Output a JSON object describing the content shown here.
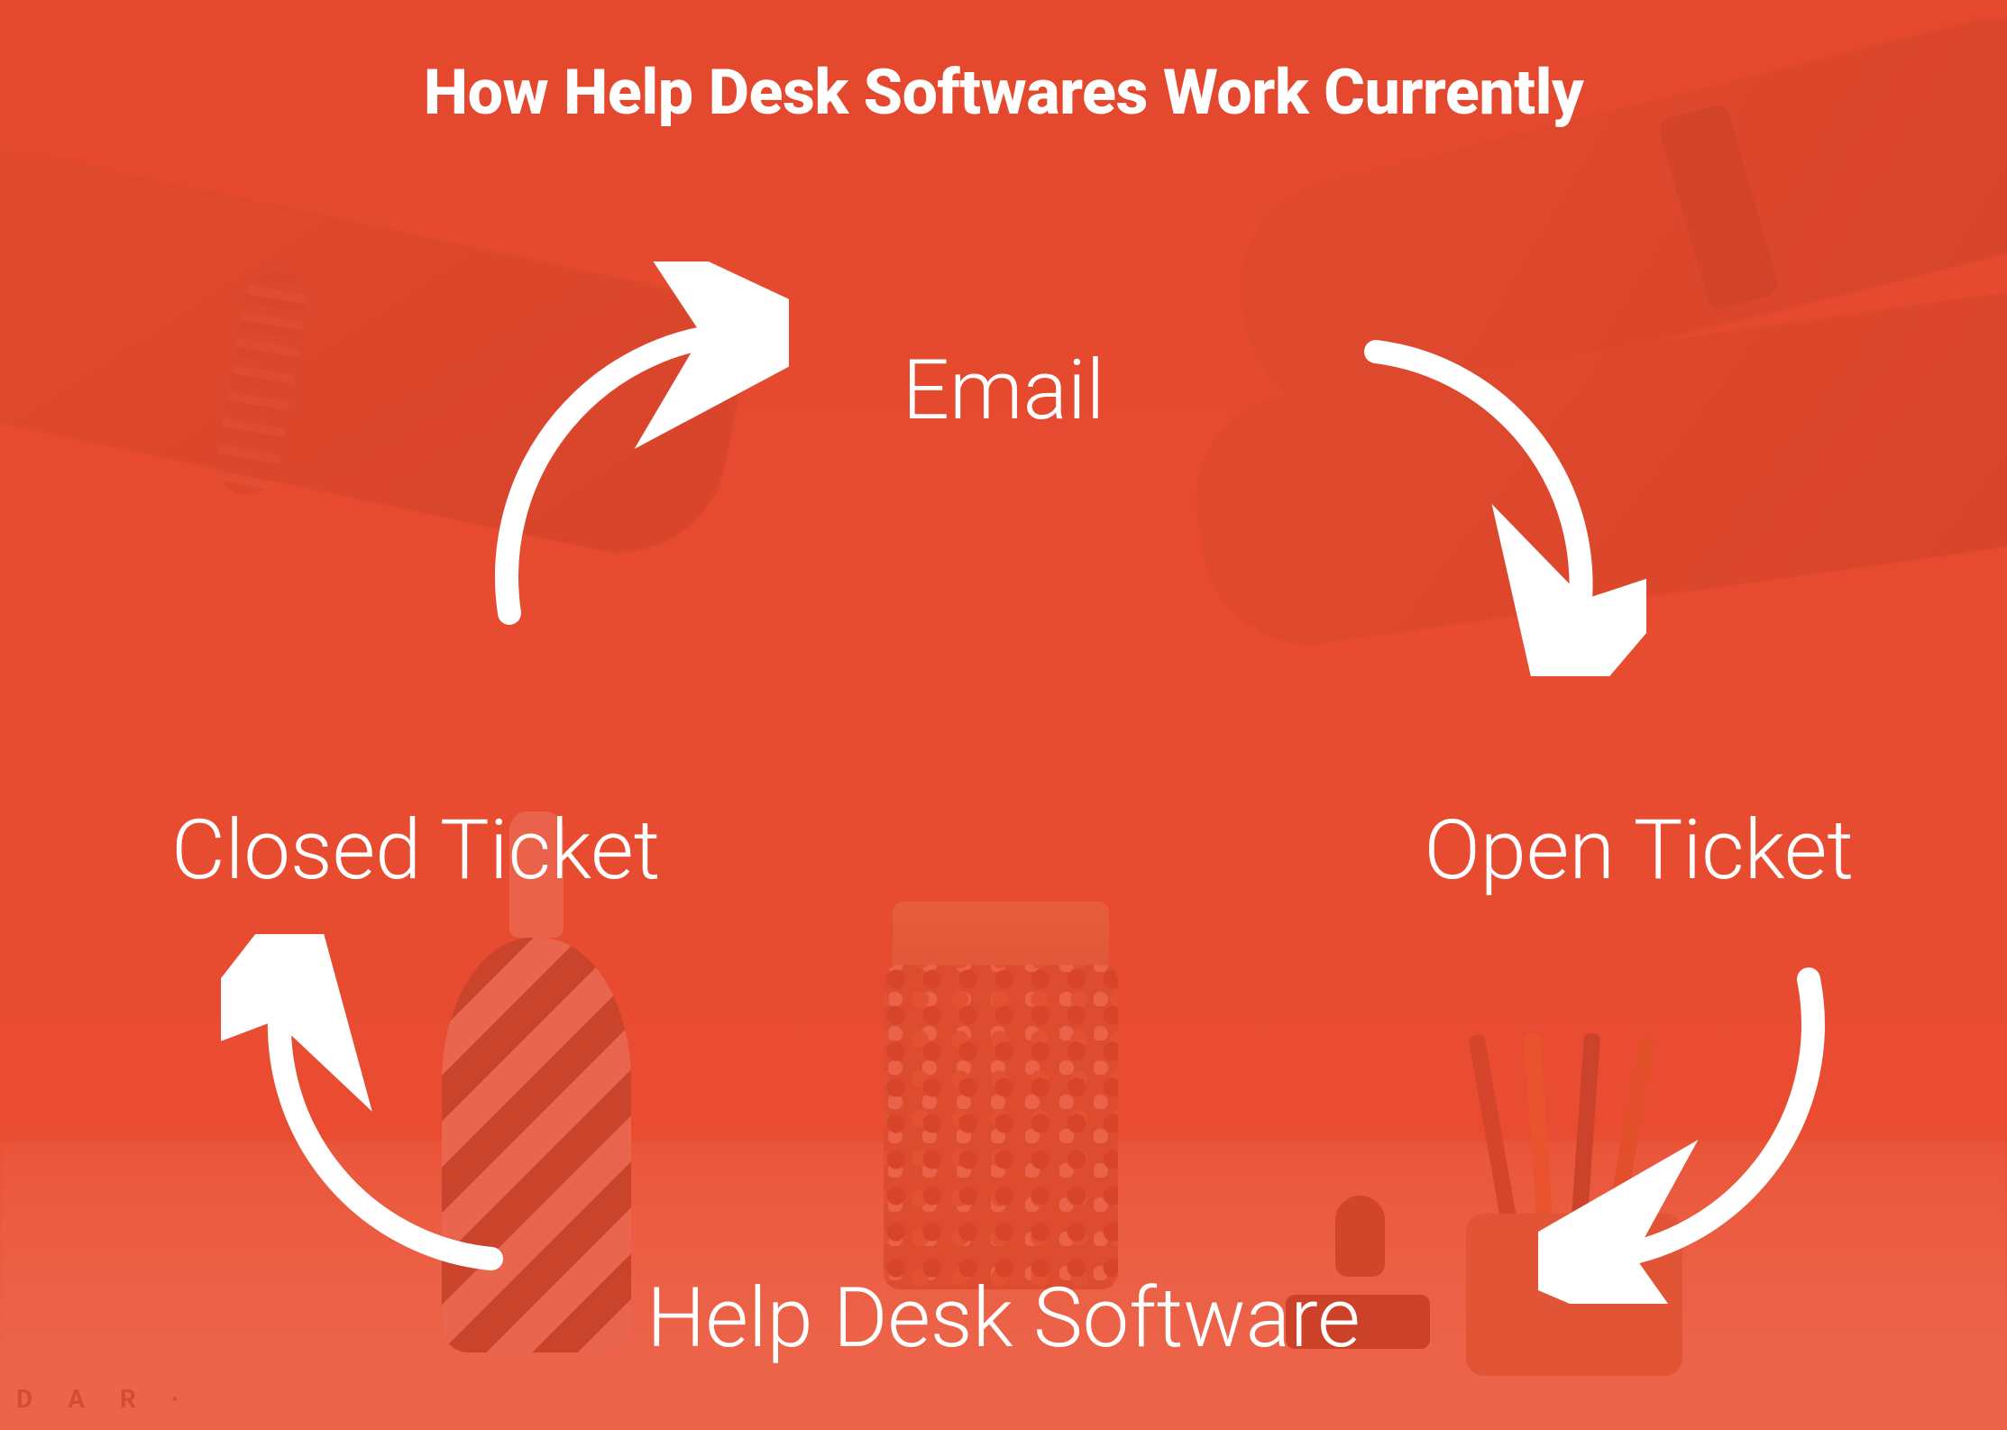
{
  "title": "How Help Desk Softwares Work Currently",
  "nodes": {
    "top": "Email",
    "right": "Open Ticket",
    "bottom": "Help Desk Software",
    "left": "Closed Ticket"
  },
  "colors": {
    "overlay": "#e84a2e",
    "text": "#ffffff"
  },
  "decor": {
    "strip_text": "D A R ·"
  },
  "flow_sequence": [
    "Email",
    "Open Ticket",
    "Help Desk Software",
    "Closed Ticket"
  ],
  "diagram_type": "cycle"
}
